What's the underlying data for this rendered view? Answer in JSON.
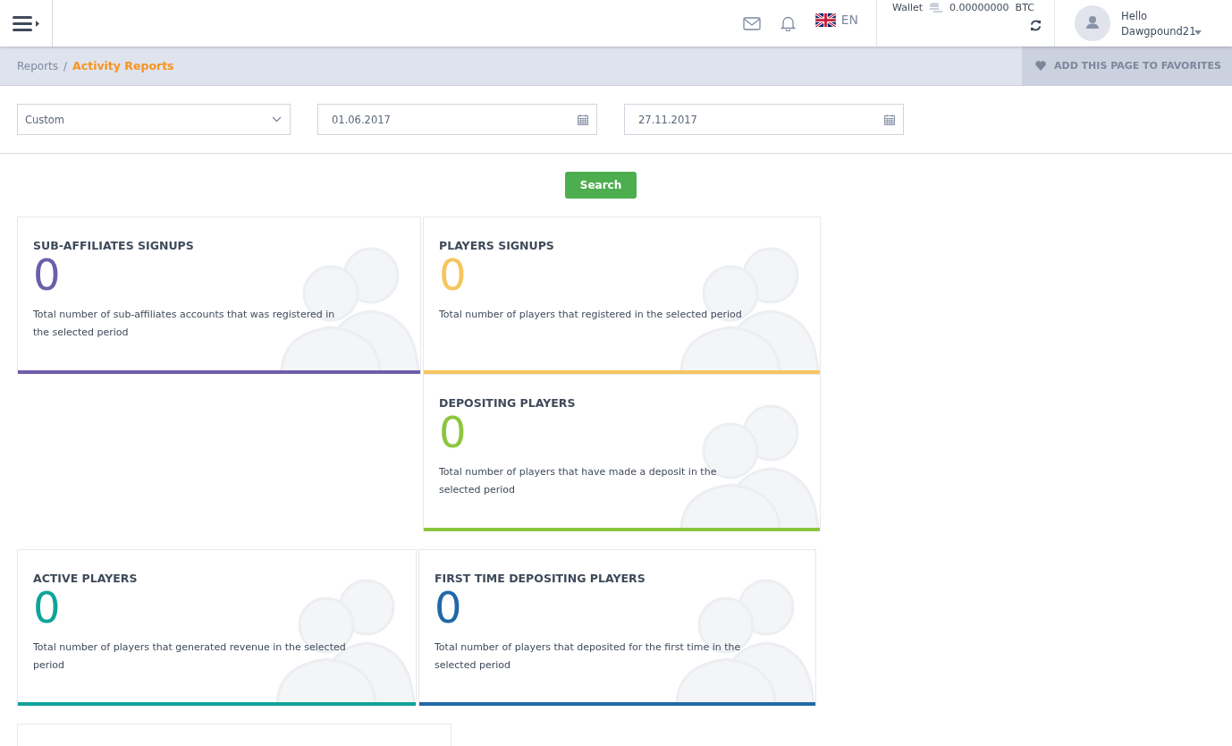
{
  "topbar": {
    "language": "EN",
    "wallet_label": "Wallet",
    "wallet_amount": "0.00000000",
    "wallet_currency": "BTC",
    "greeting": "Hello",
    "username": "Dawgpound21"
  },
  "breadcrumb": {
    "parent": "Reports",
    "separator": "/",
    "current": "Activity Reports"
  },
  "favorites_button": "ADD THIS PAGE TO FAVORITES",
  "filters": {
    "period": "Custom",
    "date_from": "01.06.2017",
    "date_to": "27.11.2017"
  },
  "search_button": "Search",
  "cards": [
    {
      "title": "SUB-AFFILIATES SIGNUPS",
      "value": "0",
      "description": "Total number of sub-affiliates accounts that was registered in the selected period",
      "color": "#6e5ea8"
    },
    {
      "title": "PLAYERS SIGNUPS",
      "value": "0",
      "description": "Total number of players that registered in the selected period",
      "color": "#f7c55e"
    },
    {
      "title": "DEPOSITING PLAYERS",
      "value": "0",
      "description": "Total number of players that have made a deposit in the selected period",
      "color": "#8cc63f"
    },
    {
      "title": "ACTIVE PLAYERS",
      "value": "0",
      "description": "Total number of players that generated revenue in the selected period",
      "color": "#0fa39a"
    },
    {
      "title": "FIRST TIME DEPOSITING PLAYERS",
      "value": "0",
      "description": "Total number of players that deposited for the first time in the selected period",
      "color": "#2168a8"
    }
  ]
}
